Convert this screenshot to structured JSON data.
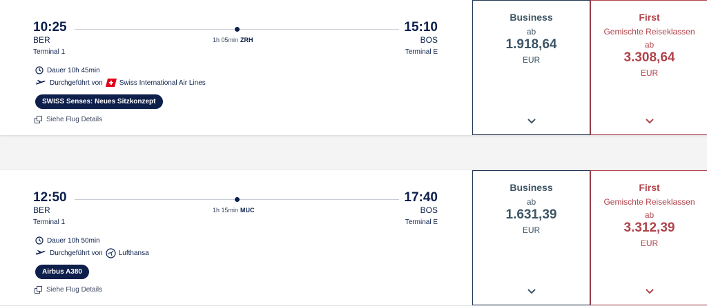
{
  "colors": {
    "navy": "#0b1f4b",
    "business": "#3d5565",
    "first": "#b0444c",
    "swiss_red": "#e2001a"
  },
  "flights": [
    {
      "dep_time": "10:25",
      "dep_code": "BER",
      "dep_terminal": "Terminal 1",
      "arr_time": "15:10",
      "arr_code": "BOS",
      "arr_terminal": "Terminal E",
      "stop_duration": "1h 05min",
      "stop_airport": "ZRH",
      "duration": "Dauer 10h 45min",
      "operated_label": "Durchgeführt von",
      "airline": "Swiss International Air Lines",
      "airline_icon": "swiss-cross-icon",
      "tag": "SWISS Senses: Neues Sitzkonzept",
      "details_link": "Siehe Flug Details",
      "business": {
        "cabin": "Business",
        "from": "ab",
        "price": "1.918,64",
        "currency": "EUR"
      },
      "first": {
        "cabin": "First",
        "mixed": "Gemischte Reiseklassen",
        "from": "ab",
        "price": "3.308,64",
        "currency": "EUR"
      }
    },
    {
      "dep_time": "12:50",
      "dep_code": "BER",
      "dep_terminal": "Terminal 1",
      "arr_time": "17:40",
      "arr_code": "BOS",
      "arr_terminal": "Terminal E",
      "stop_duration": "1h 15min",
      "stop_airport": "MUC",
      "duration": "Dauer 10h 50min",
      "operated_label": "Durchgeführt von",
      "airline": "Lufthansa",
      "airline_icon": "lufthansa-crane-icon",
      "tag": "Airbus A380",
      "details_link": "Siehe Flug Details",
      "business": {
        "cabin": "Business",
        "from": "ab",
        "price": "1.631,39",
        "currency": "EUR"
      },
      "first": {
        "cabin": "First",
        "mixed": "Gemischte Reiseklassen",
        "from": "ab",
        "price": "3.312,39",
        "currency": "EUR"
      }
    }
  ]
}
